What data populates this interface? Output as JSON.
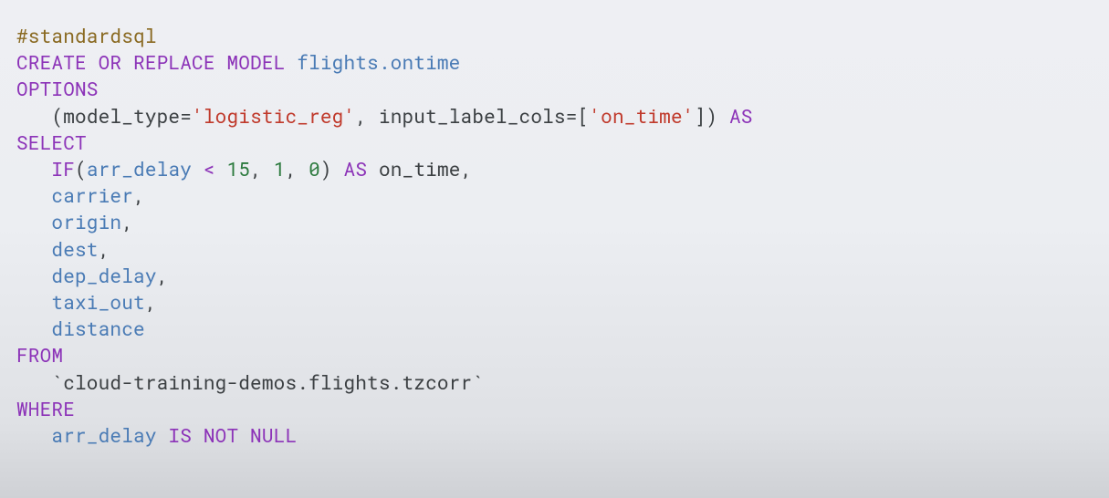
{
  "code": {
    "l1": {
      "a": "#standardsql"
    },
    "l2": {
      "a": "CREATE OR REPLACE MODEL ",
      "b": "flights.ontime"
    },
    "l3": {
      "a": "OPTIONS"
    },
    "l4": {
      "a": "   (",
      "b": "model_type",
      "c": "=",
      "d": "'logistic_reg'",
      "e": ", ",
      "f": "input_label_cols",
      "g": "=[",
      "h": "'on_time'",
      "i": "]) ",
      "j": "AS"
    },
    "l5": {
      "a": "SELECT"
    },
    "l6": {
      "a": "   ",
      "b": "IF",
      "c": "(",
      "d": "arr_delay ",
      "e": "< ",
      "f": "15",
      "g": ", ",
      "h": "1",
      "i": ", ",
      "j": "0",
      "k": ") ",
      "l": "AS ",
      "m": "on_time",
      "n": ","
    },
    "l7": {
      "a": "   ",
      "b": "carrier",
      "c": ","
    },
    "l8": {
      "a": "   ",
      "b": "origin",
      "c": ","
    },
    "l9": {
      "a": "   ",
      "b": "dest",
      "c": ","
    },
    "l10": {
      "a": "   ",
      "b": "dep_delay",
      "c": ","
    },
    "l11": {
      "a": "   ",
      "b": "taxi_out",
      "c": ","
    },
    "l12": {
      "a": "   ",
      "b": "distance"
    },
    "l13": {
      "a": "FROM"
    },
    "l14": {
      "a": "   ",
      "b": "`cloud-training-demos.flights.tzcorr`"
    },
    "l15": {
      "a": "WHERE"
    },
    "l16": {
      "a": "   ",
      "b": "arr_delay ",
      "c": "IS NOT NULL"
    }
  }
}
